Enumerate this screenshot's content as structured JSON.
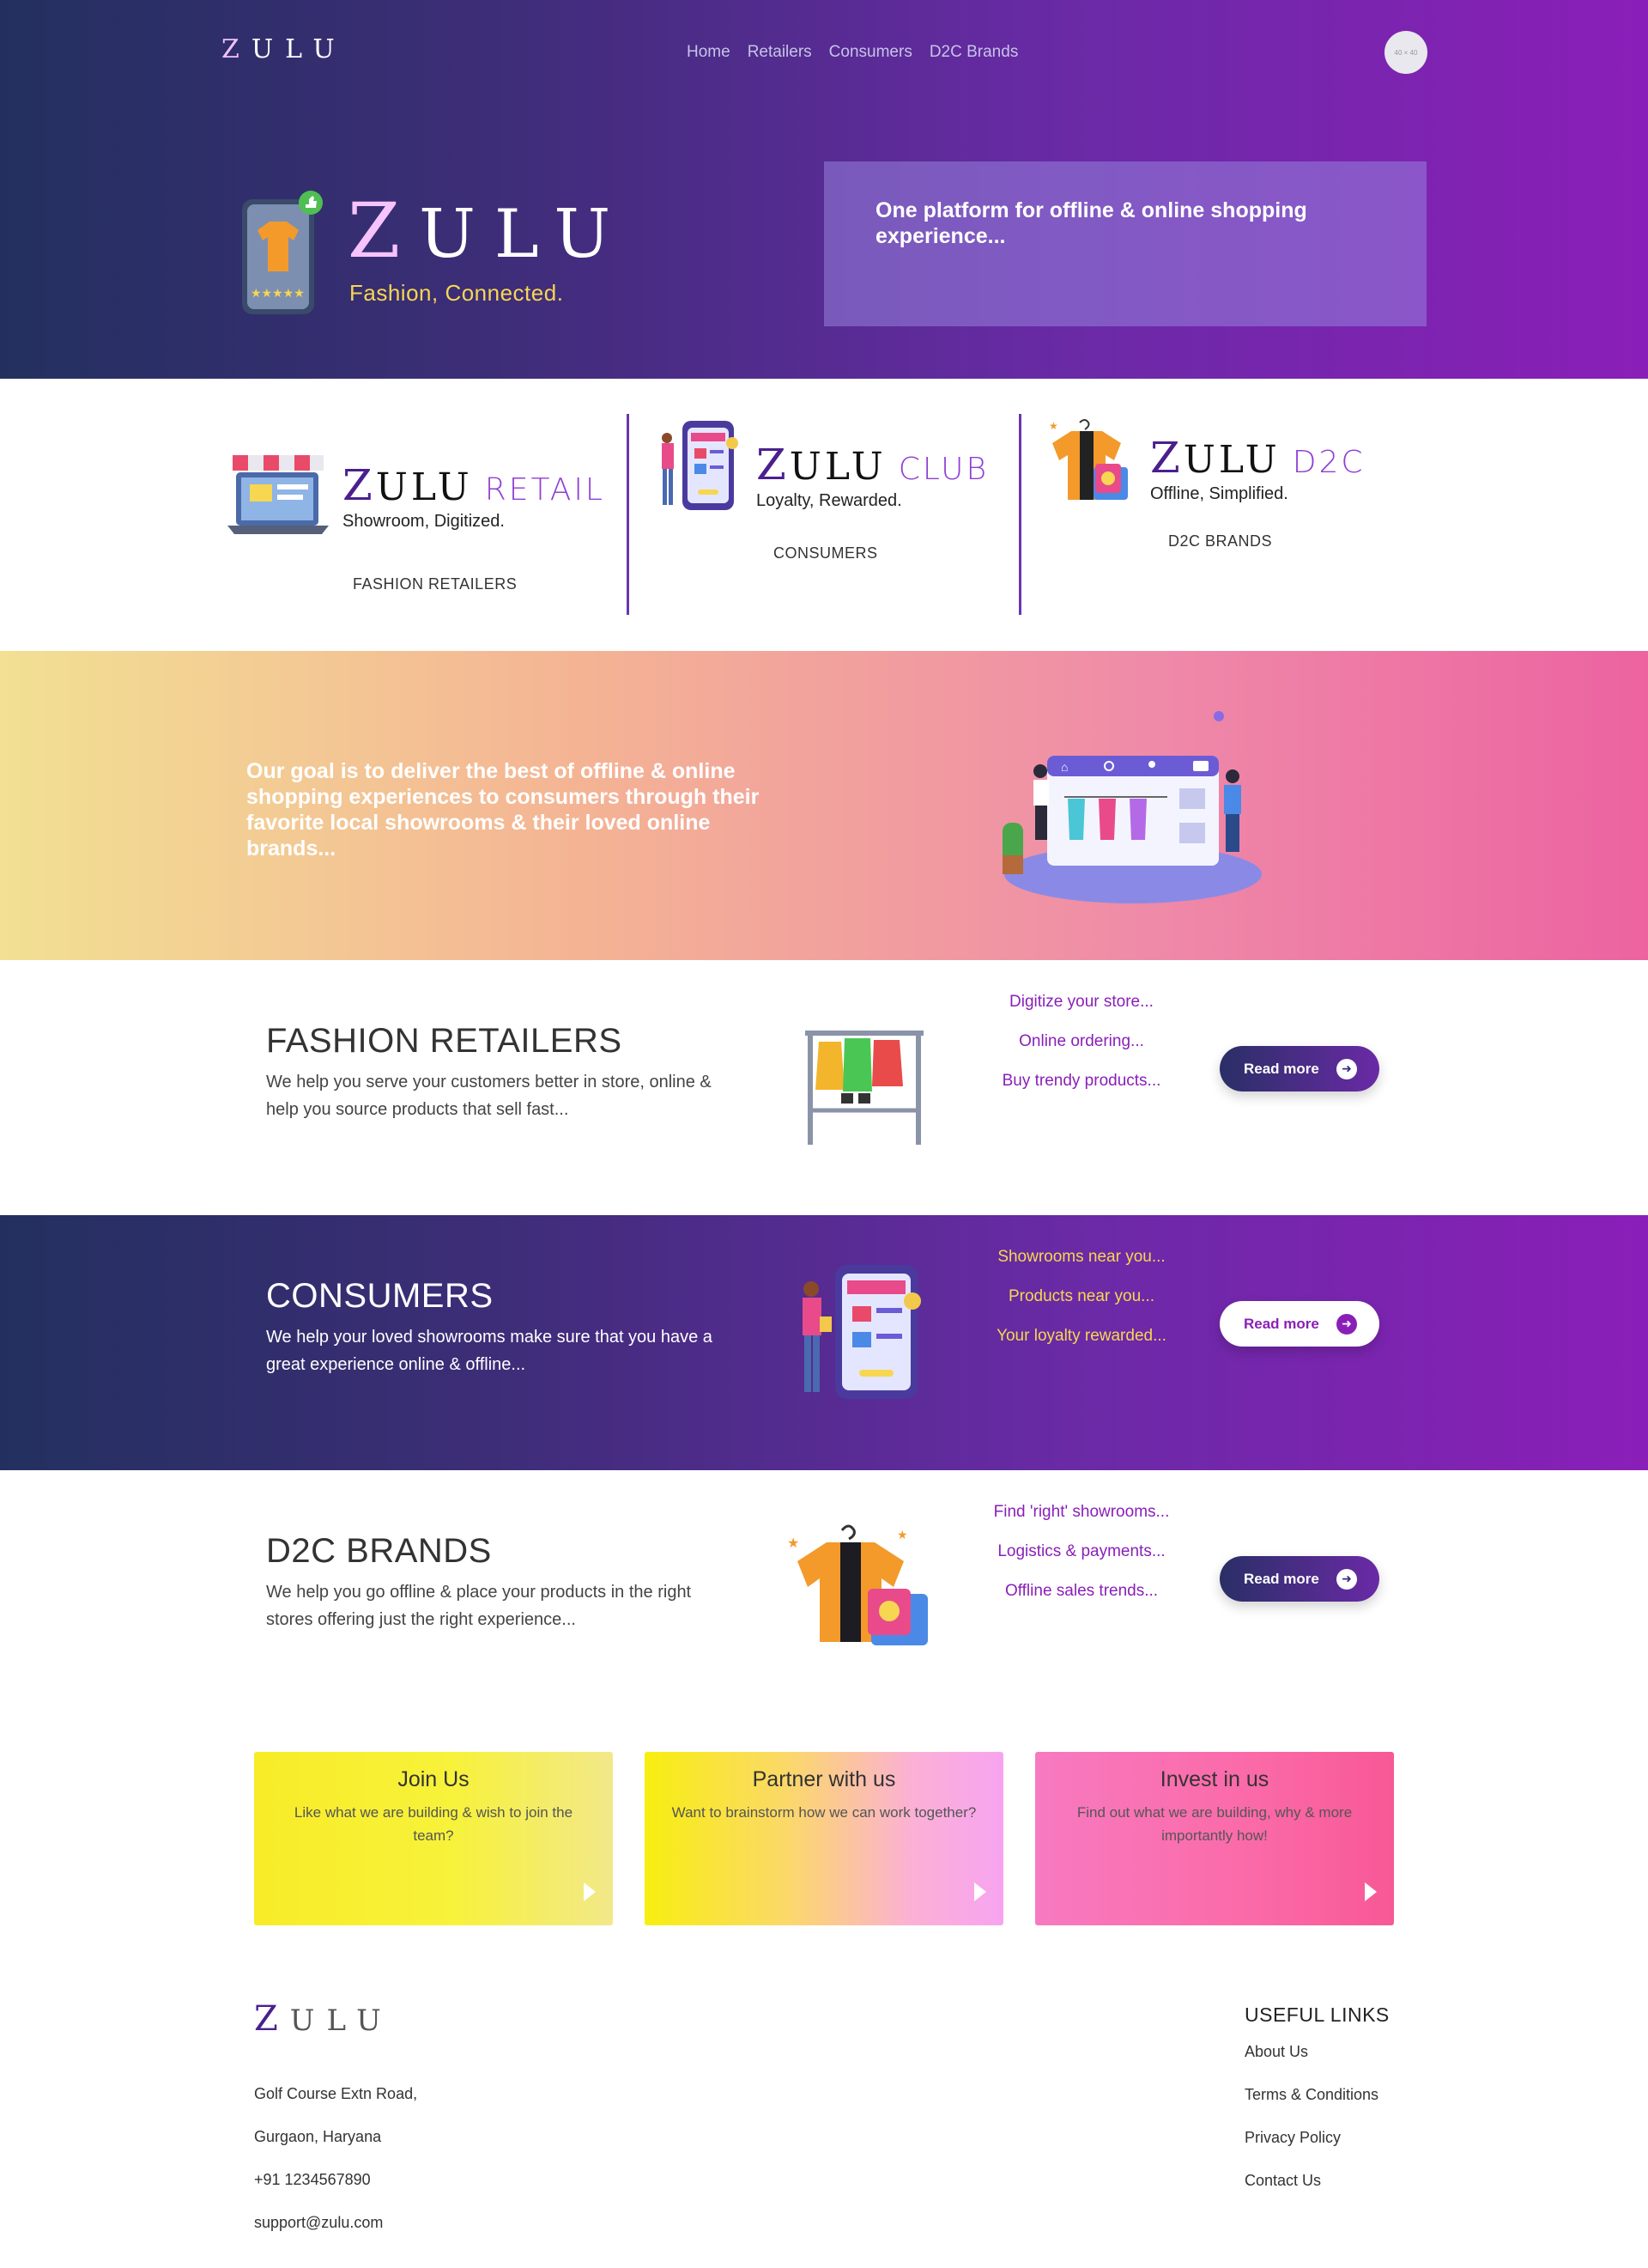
{
  "nav": {
    "logo": "ZULU",
    "links": [
      "Home",
      "Retailers",
      "Consumers",
      "D2C Brands"
    ],
    "avatar_label": "40 × 40"
  },
  "hero": {
    "brand": "ZULU",
    "tagline": "Fashion, Connected.",
    "pitch": "One platform for offline & online shopping experience..."
  },
  "brands": [
    {
      "name": "ZULU",
      "suffix": "RETAIL",
      "tagline": "Showroom, Digitized.",
      "caption": "FASHION RETAILERS"
    },
    {
      "name": "ZULU",
      "suffix": "CLUB",
      "tagline": "Loyalty, Rewarded.",
      "caption": "CONSUMERS"
    },
    {
      "name": "ZULU",
      "suffix": "D2C",
      "tagline": "Offline, Simplified.",
      "caption": "D2C BRANDS"
    }
  ],
  "goal": {
    "text": "Our goal is to deliver the best of offline & online shopping experiences to consumers through their favorite local showrooms & their loved online brands..."
  },
  "sections": [
    {
      "title": "FASHION RETAILERS",
      "description": "We help you serve your customers better in store, online & help you source products that sell fast...",
      "links": [
        "Digitize your store...",
        "Online ordering...",
        "Buy trendy products..."
      ],
      "button": "Read more"
    },
    {
      "title": "CONSUMERS",
      "description": "We help your loved showrooms make sure that you have a great experience online & offline...",
      "links": [
        "Showrooms near you...",
        "Products near you...",
        "Your loyalty rewarded..."
      ],
      "button": "Read more"
    },
    {
      "title": "D2C BRANDS",
      "description": "We help you go offline & place your products in the right stores offering just the right experience...",
      "links": [
        "Find 'right' showrooms...",
        "Logistics & payments...",
        "Offline sales trends..."
      ],
      "button": "Read more"
    }
  ],
  "cards": [
    {
      "title": "Join Us",
      "text": "Like what we are building & wish to join the team?"
    },
    {
      "title": "Partner with us",
      "text": "Want to brainstorm how we can work together?"
    },
    {
      "title": "Invest in us",
      "text": "Find out what we are building, why & more importantly how!"
    }
  ],
  "footer": {
    "logo": "ZULU",
    "address": [
      "Golf Course Extn Road,",
      "Gurgaon, Haryana"
    ],
    "phone": "+91 1234567890",
    "email": "support@zulu.com",
    "links_title": "USEFUL LINKS",
    "links": [
      "About Us",
      "Terms & Conditions",
      "Privacy Policy",
      "Contact Us"
    ]
  },
  "colors": {
    "hero_start": "#23305f",
    "hero_end": "#8a1fb8",
    "accent_purple": "#8a1fb8",
    "consumers_link": "#f7d652",
    "goal_start": "#f2e093",
    "goal_end": "#ec63a0"
  }
}
